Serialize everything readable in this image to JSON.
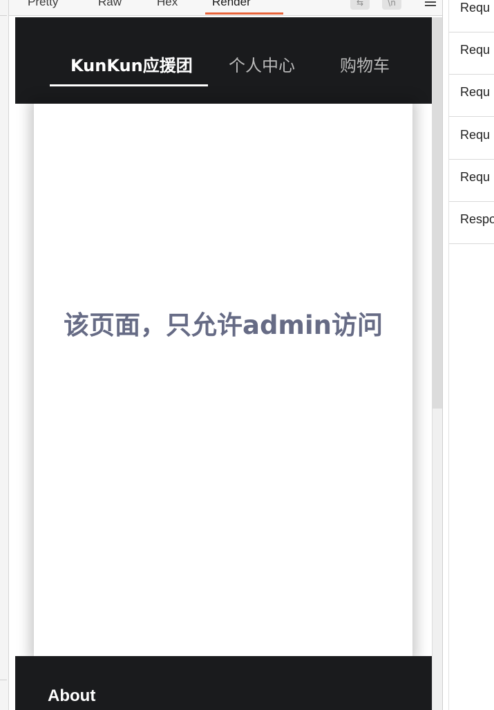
{
  "tabs": [
    {
      "label": "Pretty"
    },
    {
      "label": "Raw"
    },
    {
      "label": "Hex"
    },
    {
      "label": "Render"
    }
  ],
  "active_tab": "Render",
  "toolbar": {
    "wrap_icon": "wrap-lines-icon",
    "newline_icon": "newline-icon",
    "menu_icon": "hamburger-menu-icon"
  },
  "site": {
    "nav": [
      {
        "label": "KunKun应援团",
        "active": true
      },
      {
        "label": "个人中心",
        "active": false
      },
      {
        "label": "购物车",
        "active": false
      }
    ],
    "message": "该页面，只允许admin访问",
    "footer_title": "About"
  },
  "inspector": {
    "rows": [
      {
        "label": "Requ"
      },
      {
        "label": "Requ"
      },
      {
        "label": "Requ"
      },
      {
        "label": "Requ"
      },
      {
        "label": "Requ"
      },
      {
        "label": "Respo"
      }
    ]
  },
  "colors": {
    "accent": "#e8643a",
    "nav_bg": "#1a1b1d",
    "message_text": "#666b85"
  }
}
